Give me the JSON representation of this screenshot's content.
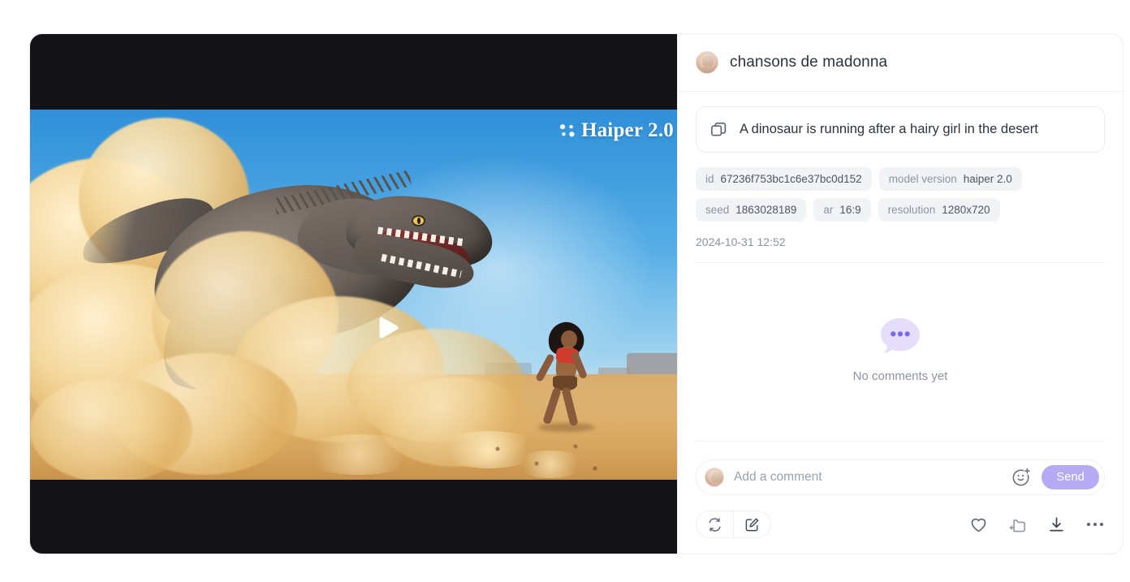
{
  "panel": {
    "title": "chansons de madonna",
    "avatar_icon": "user-avatar"
  },
  "prompt": {
    "icon": "copy-icon",
    "text": "A dinosaur is running after a hairy girl in the desert"
  },
  "metadata": [
    {
      "key": "id",
      "value": "67236f753bc1c6e37bc0d152"
    },
    {
      "key": "model version",
      "value": "haiper 2.0"
    },
    {
      "key": "seed",
      "value": "1863028189"
    },
    {
      "key": "ar",
      "value": "16:9"
    },
    {
      "key": "resolution",
      "value": "1280x720"
    }
  ],
  "timestamp": "2024-10-31 12:52",
  "comments": {
    "empty_icon": "speech-bubble-icon",
    "empty_label": "No comments yet",
    "input_placeholder": "Add a comment",
    "input_value": "",
    "emoji_icon": "add-emoji-icon",
    "send_label": "Send"
  },
  "actions": {
    "regenerate_icon": "regenerate-icon",
    "edit_icon": "edit-icon",
    "like_icon": "heart-icon",
    "collect_icon": "add-to-folder-icon",
    "download_icon": "download-icon",
    "more_icon": "more-options-icon"
  },
  "video": {
    "watermark_text": "Haiper 2.0",
    "watermark_logo": "haiper-logo-icon",
    "play_icon": "play-icon"
  },
  "colors": {
    "accent": "#b7aaf5",
    "text_primary": "#2b3240",
    "text_muted": "#8d93a3",
    "chip_bg": "#f2f3f6",
    "video_bg": "#121217"
  }
}
